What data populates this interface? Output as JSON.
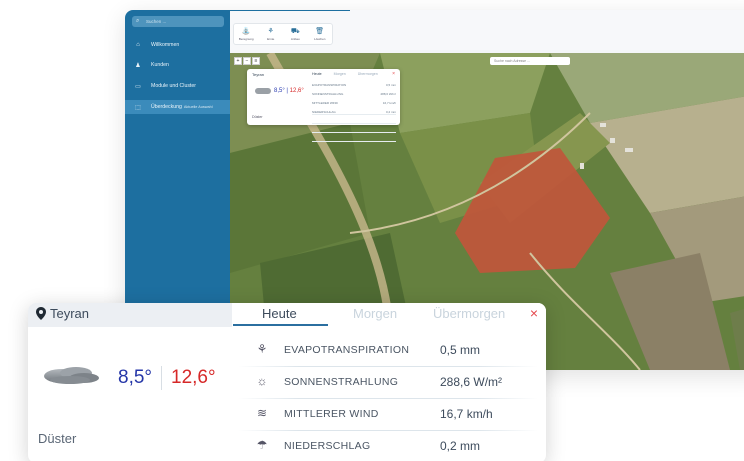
{
  "sidebar": {
    "search_placeholder": "Suchen ...",
    "items": [
      {
        "label": "Willkommen",
        "icon": "home-icon"
      },
      {
        "label": "Kunden",
        "icon": "users-icon"
      },
      {
        "label": "Module und Cluster",
        "icon": "modules-icon"
      },
      {
        "label": "Überdeckung",
        "sub": "Aktuelle Auswahl",
        "icon": "overlap-icon",
        "active": true
      }
    ]
  },
  "toolbar": {
    "tools": [
      {
        "label": "Beregnung",
        "icon": "irrigation-icon"
      },
      {
        "label": "Ernte",
        "icon": "harvest-icon"
      },
      {
        "label": "Anbau",
        "icon": "tractor-icon"
      },
      {
        "label": "Löschen",
        "icon": "trash-icon"
      }
    ]
  },
  "map": {
    "search_placeholder": "Suche nach Adresse ..."
  },
  "mini_weather": {
    "location": "Teyran",
    "tabs": [
      "Heute",
      "Morgen",
      "Übermorgen"
    ],
    "temp_min": "8,5°",
    "temp_max": "12,6°",
    "condition": "Düster",
    "rows": [
      {
        "label": "EVAPOTRANSPIRATION",
        "value": "0,5 mm"
      },
      {
        "label": "SONNENSTRAHLUNG",
        "value": "288,6 W/m²"
      },
      {
        "label": "MITTLERER WIND",
        "value": "16,7 km/h"
      },
      {
        "label": "NIEDERSCHLAG",
        "value": "0,2 mm"
      }
    ]
  },
  "weather": {
    "location": "Teyran",
    "tabs": {
      "today": "Heute",
      "tomorrow": "Morgen",
      "after": "Übermorgen"
    },
    "close": "×",
    "temp_min": "8,5°",
    "temp_max": "12,6°",
    "condition": "Düster",
    "metrics": [
      {
        "label": "EVAPOTRANSPIRATION",
        "value": "0,5 mm",
        "icon": "evapotranspiration-icon"
      },
      {
        "label": "SONNENSTRAHLUNG",
        "value": "288,6 W/m²",
        "icon": "sun-radiation-icon"
      },
      {
        "label": "MITTLERER WIND",
        "value": "16,7 km/h",
        "icon": "wind-icon"
      },
      {
        "label": "NIEDERSCHLAG",
        "value": "0,2 mm",
        "icon": "precipitation-icon"
      }
    ]
  },
  "colors": {
    "sidebar": "#1d6fa0",
    "temp_min": "#2536a8",
    "temp_max": "#d62828",
    "close": "#e5484d",
    "tab_active": "#2b6fa0",
    "field_highlight": "#c0563b"
  }
}
